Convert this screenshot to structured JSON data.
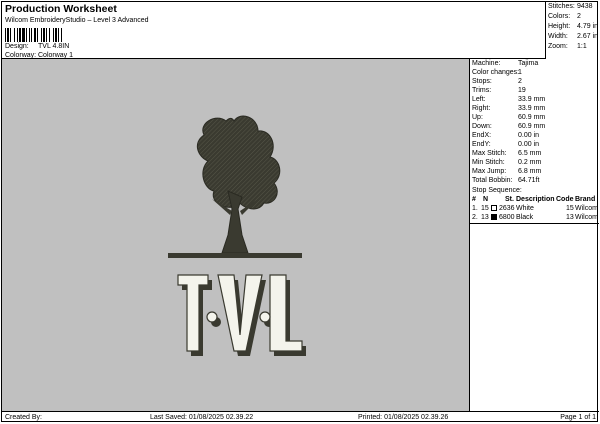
{
  "header": {
    "title": "Production Worksheet",
    "subtitle": "Wilcom EmbroideryStudio – Level 3 Advanced",
    "design_label": "Design:",
    "design_value": "TVL 4.8IN",
    "colorway_label": "Colorway:",
    "colorway_value": "Colorway 1"
  },
  "summary": [
    {
      "label": "Stitches:",
      "value": "9438"
    },
    {
      "label": "Colors:",
      "value": "2"
    },
    {
      "label": "Height:",
      "value": "4.79 in"
    },
    {
      "label": "Width:",
      "value": "2.67 in"
    },
    {
      "label": "Zoom:",
      "value": "1:1"
    }
  ],
  "machine_info": [
    {
      "label": "Machine:",
      "value": "Tajima"
    },
    {
      "label": "Color changes:",
      "value": "1"
    },
    {
      "label": "Stops:",
      "value": "2"
    },
    {
      "label": "Trims:",
      "value": "19"
    },
    {
      "label": "Left:",
      "value": "33.9 mm"
    },
    {
      "label": "Right:",
      "value": "33.9 mm"
    },
    {
      "label": "Up:",
      "value": "60.9 mm"
    },
    {
      "label": "Down:",
      "value": "60.9 mm"
    },
    {
      "label": "EndX:",
      "value": "0.00 in"
    },
    {
      "label": "EndY:",
      "value": "0.00 in"
    },
    {
      "label": "Max Stitch:",
      "value": "6.5 mm"
    },
    {
      "label": "Min Stitch:",
      "value": "0.2 mm"
    },
    {
      "label": "Max Jump:",
      "value": "6.8 mm"
    },
    {
      "label": "Total Bobbin:",
      "value": "64.71ft"
    }
  ],
  "stop_sequence": {
    "title": "Stop Sequence:",
    "headers": [
      "#",
      "N",
      "St.",
      "Description",
      "Code",
      "Brand"
    ],
    "rows": [
      {
        "num": "1.",
        "n": "15",
        "swatch": "#ffffff",
        "st": "2636",
        "description": "White",
        "code": "15",
        "brand": "Wilcom"
      },
      {
        "num": "2.",
        "n": "13",
        "swatch": "#000000",
        "st": "6800",
        "description": "Black",
        "code": "13",
        "brand": "Wilcom"
      }
    ]
  },
  "design": {
    "letters": [
      "T",
      "V",
      "L"
    ],
    "thread_dark": "#3a3a30",
    "thread_light": "#f4f4ec",
    "background": "#c0c0c0"
  },
  "footer": {
    "created_by": "Created By:",
    "last_saved": "Last Saved: 01/08/2025 02.39.22",
    "printed": "Printed: 01/08/2025 02.39.26",
    "page": "Page 1 of 1"
  }
}
